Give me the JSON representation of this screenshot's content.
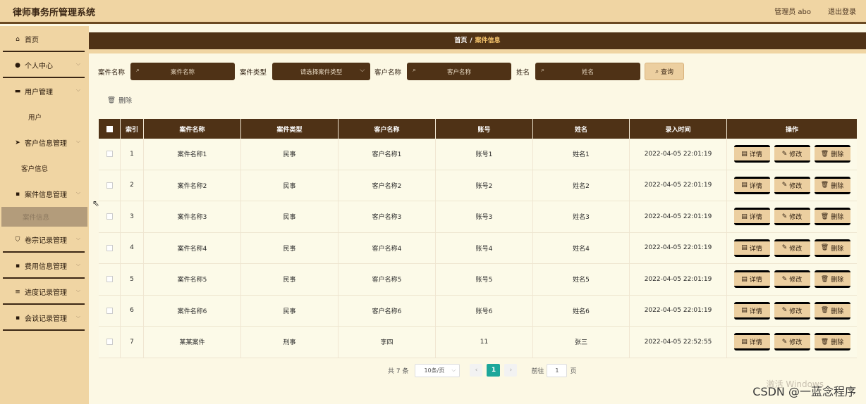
{
  "app": {
    "title": "律师事务所管理系统",
    "user": "管理员 abo",
    "logout": "退出登录"
  },
  "sidebar": {
    "items": [
      {
        "label": "首页",
        "icon": "home-icon",
        "glyph": "⌂"
      },
      {
        "label": "个人中心",
        "icon": "person-icon",
        "glyph": "●"
      },
      {
        "label": "用户管理",
        "icon": "briefcase-icon",
        "glyph": "▬"
      },
      {
        "label": "用户"
      },
      {
        "label": "客户信息管理",
        "icon": "send-icon",
        "glyph": "➤"
      },
      {
        "label": "客户信息"
      },
      {
        "label": "案件信息管理",
        "icon": "grid-icon",
        "glyph": "▪"
      },
      {
        "label": "案件信息"
      },
      {
        "label": "卷宗记录管理",
        "icon": "shield-icon",
        "glyph": "⛉"
      },
      {
        "label": "费用信息管理",
        "icon": "grid-icon",
        "glyph": "▪"
      },
      {
        "label": "进度记录管理",
        "icon": "list-icon",
        "glyph": "≡"
      },
      {
        "label": "会谈记录管理",
        "icon": "grid-icon",
        "glyph": "▪"
      }
    ]
  },
  "breadcrumb": {
    "home": "首页",
    "sep": "/",
    "current": "案件信息"
  },
  "search": {
    "case_name_label": "案件名称",
    "case_name_placeholder": "案件名称",
    "case_type_label": "案件类型",
    "case_type_placeholder": "请选择案件类型",
    "client_name_label": "客户名称",
    "client_name_placeholder": "客户名称",
    "name_label": "姓名",
    "name_placeholder": "姓名",
    "query_button": "查询"
  },
  "toolbar": {
    "delete_label": "删除"
  },
  "table": {
    "headers": [
      "索引",
      "案件名称",
      "案件类型",
      "客户名称",
      "账号",
      "姓名",
      "录入时间",
      "操作"
    ],
    "rows": [
      [
        "1",
        "案件名称1",
        "民事",
        "客户名称1",
        "账号1",
        "姓名1",
        "2022-04-05 22:01:19"
      ],
      [
        "2",
        "案件名称2",
        "民事",
        "客户名称2",
        "账号2",
        "姓名2",
        "2022-04-05 22:01:19"
      ],
      [
        "3",
        "案件名称3",
        "民事",
        "客户名称3",
        "账号3",
        "姓名3",
        "2022-04-05 22:01:19"
      ],
      [
        "4",
        "案件名称4",
        "民事",
        "客户名称4",
        "账号4",
        "姓名4",
        "2022-04-05 22:01:19"
      ],
      [
        "5",
        "案件名称5",
        "民事",
        "客户名称5",
        "账号5",
        "姓名5",
        "2022-04-05 22:01:19"
      ],
      [
        "6",
        "案件名称6",
        "民事",
        "客户名称6",
        "账号6",
        "姓名6",
        "2022-04-05 22:01:19"
      ],
      [
        "7",
        "某某案件",
        "刑事",
        "李四",
        "11",
        "张三",
        "2022-04-05 22:52:55"
      ]
    ],
    "actions": {
      "detail": "详情",
      "edit": "修改",
      "delete": "删除"
    }
  },
  "pager": {
    "total": "共 7 条",
    "page_size": "10条/页",
    "current_page": "1",
    "goto": "前往",
    "goto_value": "1",
    "page_unit": "页"
  },
  "watermark": {
    "activate": "激活 Windows",
    "csdn": "CSDN @一蓝念程序"
  }
}
